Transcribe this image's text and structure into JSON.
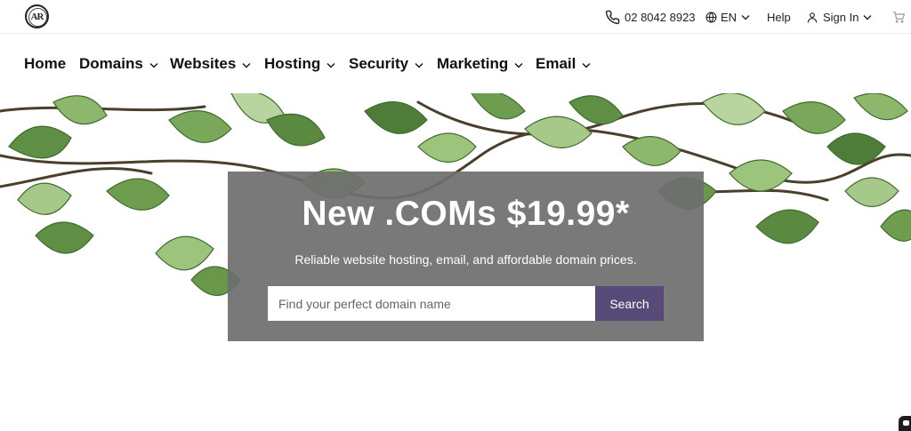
{
  "topbar": {
    "logo_text": "AR",
    "phone": "02 8042 8923",
    "language": "EN",
    "help": "Help",
    "sign_in": "Sign In"
  },
  "nav": {
    "items": [
      {
        "label": "Home",
        "has_dropdown": false
      },
      {
        "label": "Domains",
        "has_dropdown": true
      },
      {
        "label": "Websites",
        "has_dropdown": true
      },
      {
        "label": "Hosting",
        "has_dropdown": true
      },
      {
        "label": "Security",
        "has_dropdown": true
      },
      {
        "label": "Marketing",
        "has_dropdown": true
      },
      {
        "label": "Email",
        "has_dropdown": true
      }
    ]
  },
  "hero": {
    "title": "New .COMs $19.99*",
    "subtitle": "Reliable website hosting, email, and affordable domain prices.",
    "search_placeholder": "Find your perfect domain name",
    "search_button": "Search"
  },
  "colors": {
    "accent": "#564a78",
    "panel": "#6e6e6e",
    "leaf_dark": "#4e7d3a",
    "leaf_light": "#9cc47c"
  },
  "icons": [
    "logo-icon",
    "phone-icon",
    "globe-icon",
    "user-icon",
    "cart-icon",
    "chevron-down-icon",
    "chat-icon"
  ]
}
